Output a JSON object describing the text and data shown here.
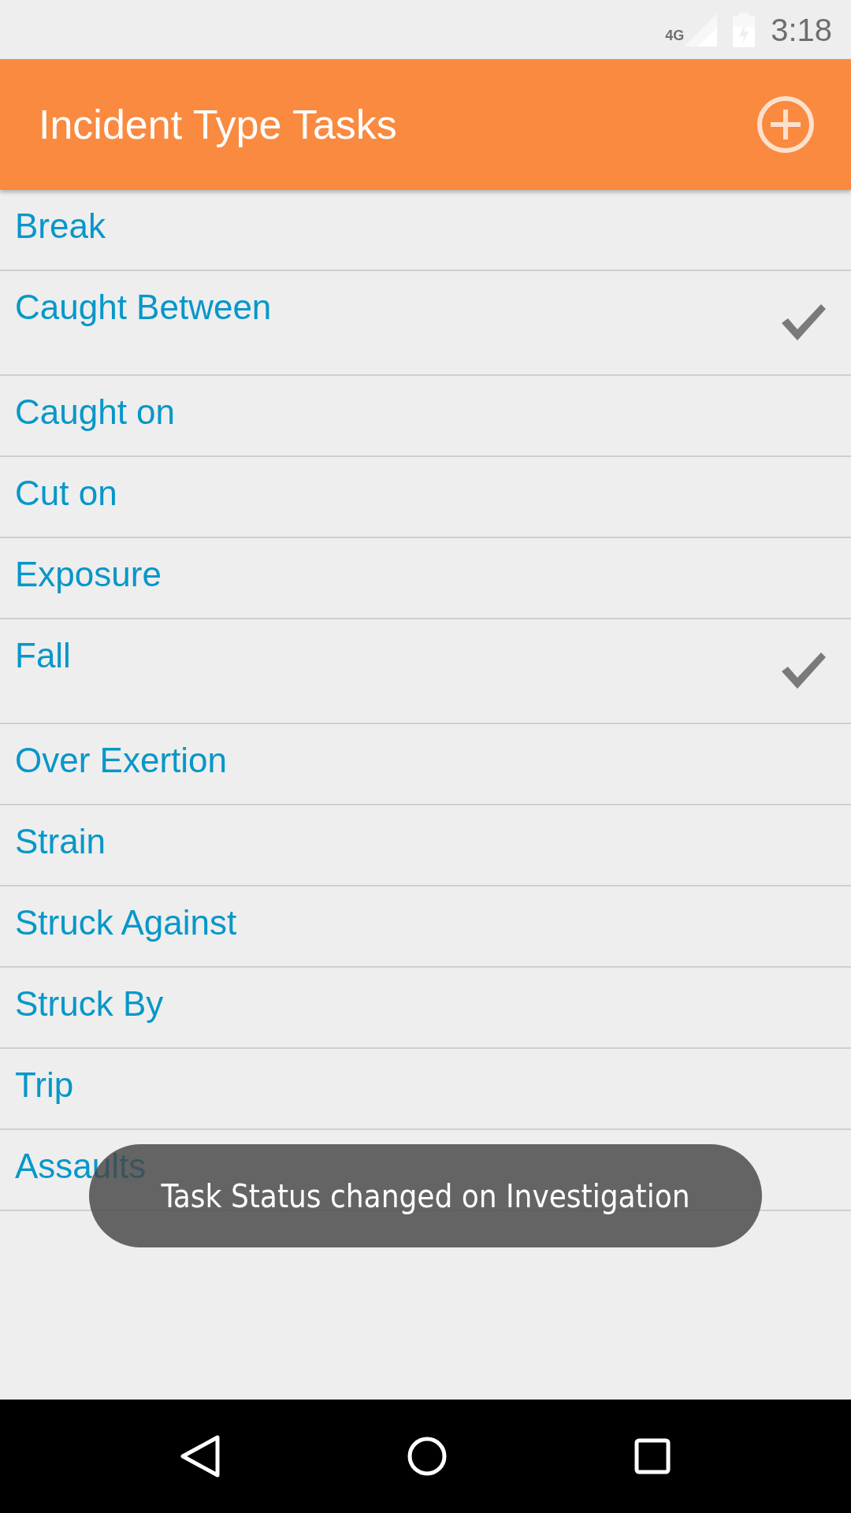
{
  "status_bar": {
    "network": "4G",
    "time": "3:18"
  },
  "app_bar": {
    "title": "Incident Type Tasks"
  },
  "tasks": [
    {
      "label": "Break",
      "checked": false
    },
    {
      "label": "Caught Between",
      "checked": true
    },
    {
      "label": "Caught on",
      "checked": false
    },
    {
      "label": "Cut on",
      "checked": false
    },
    {
      "label": "Exposure",
      "checked": false
    },
    {
      "label": "Fall",
      "checked": true
    },
    {
      "label": "Over Exertion",
      "checked": false
    },
    {
      "label": "Strain",
      "checked": false
    },
    {
      "label": "Struck Against",
      "checked": false
    },
    {
      "label": "Struck By",
      "checked": false
    },
    {
      "label": "Trip",
      "checked": false
    },
    {
      "label": "Assaults",
      "checked": false
    }
  ],
  "toast": {
    "message": "Task Status changed on Investigation"
  }
}
